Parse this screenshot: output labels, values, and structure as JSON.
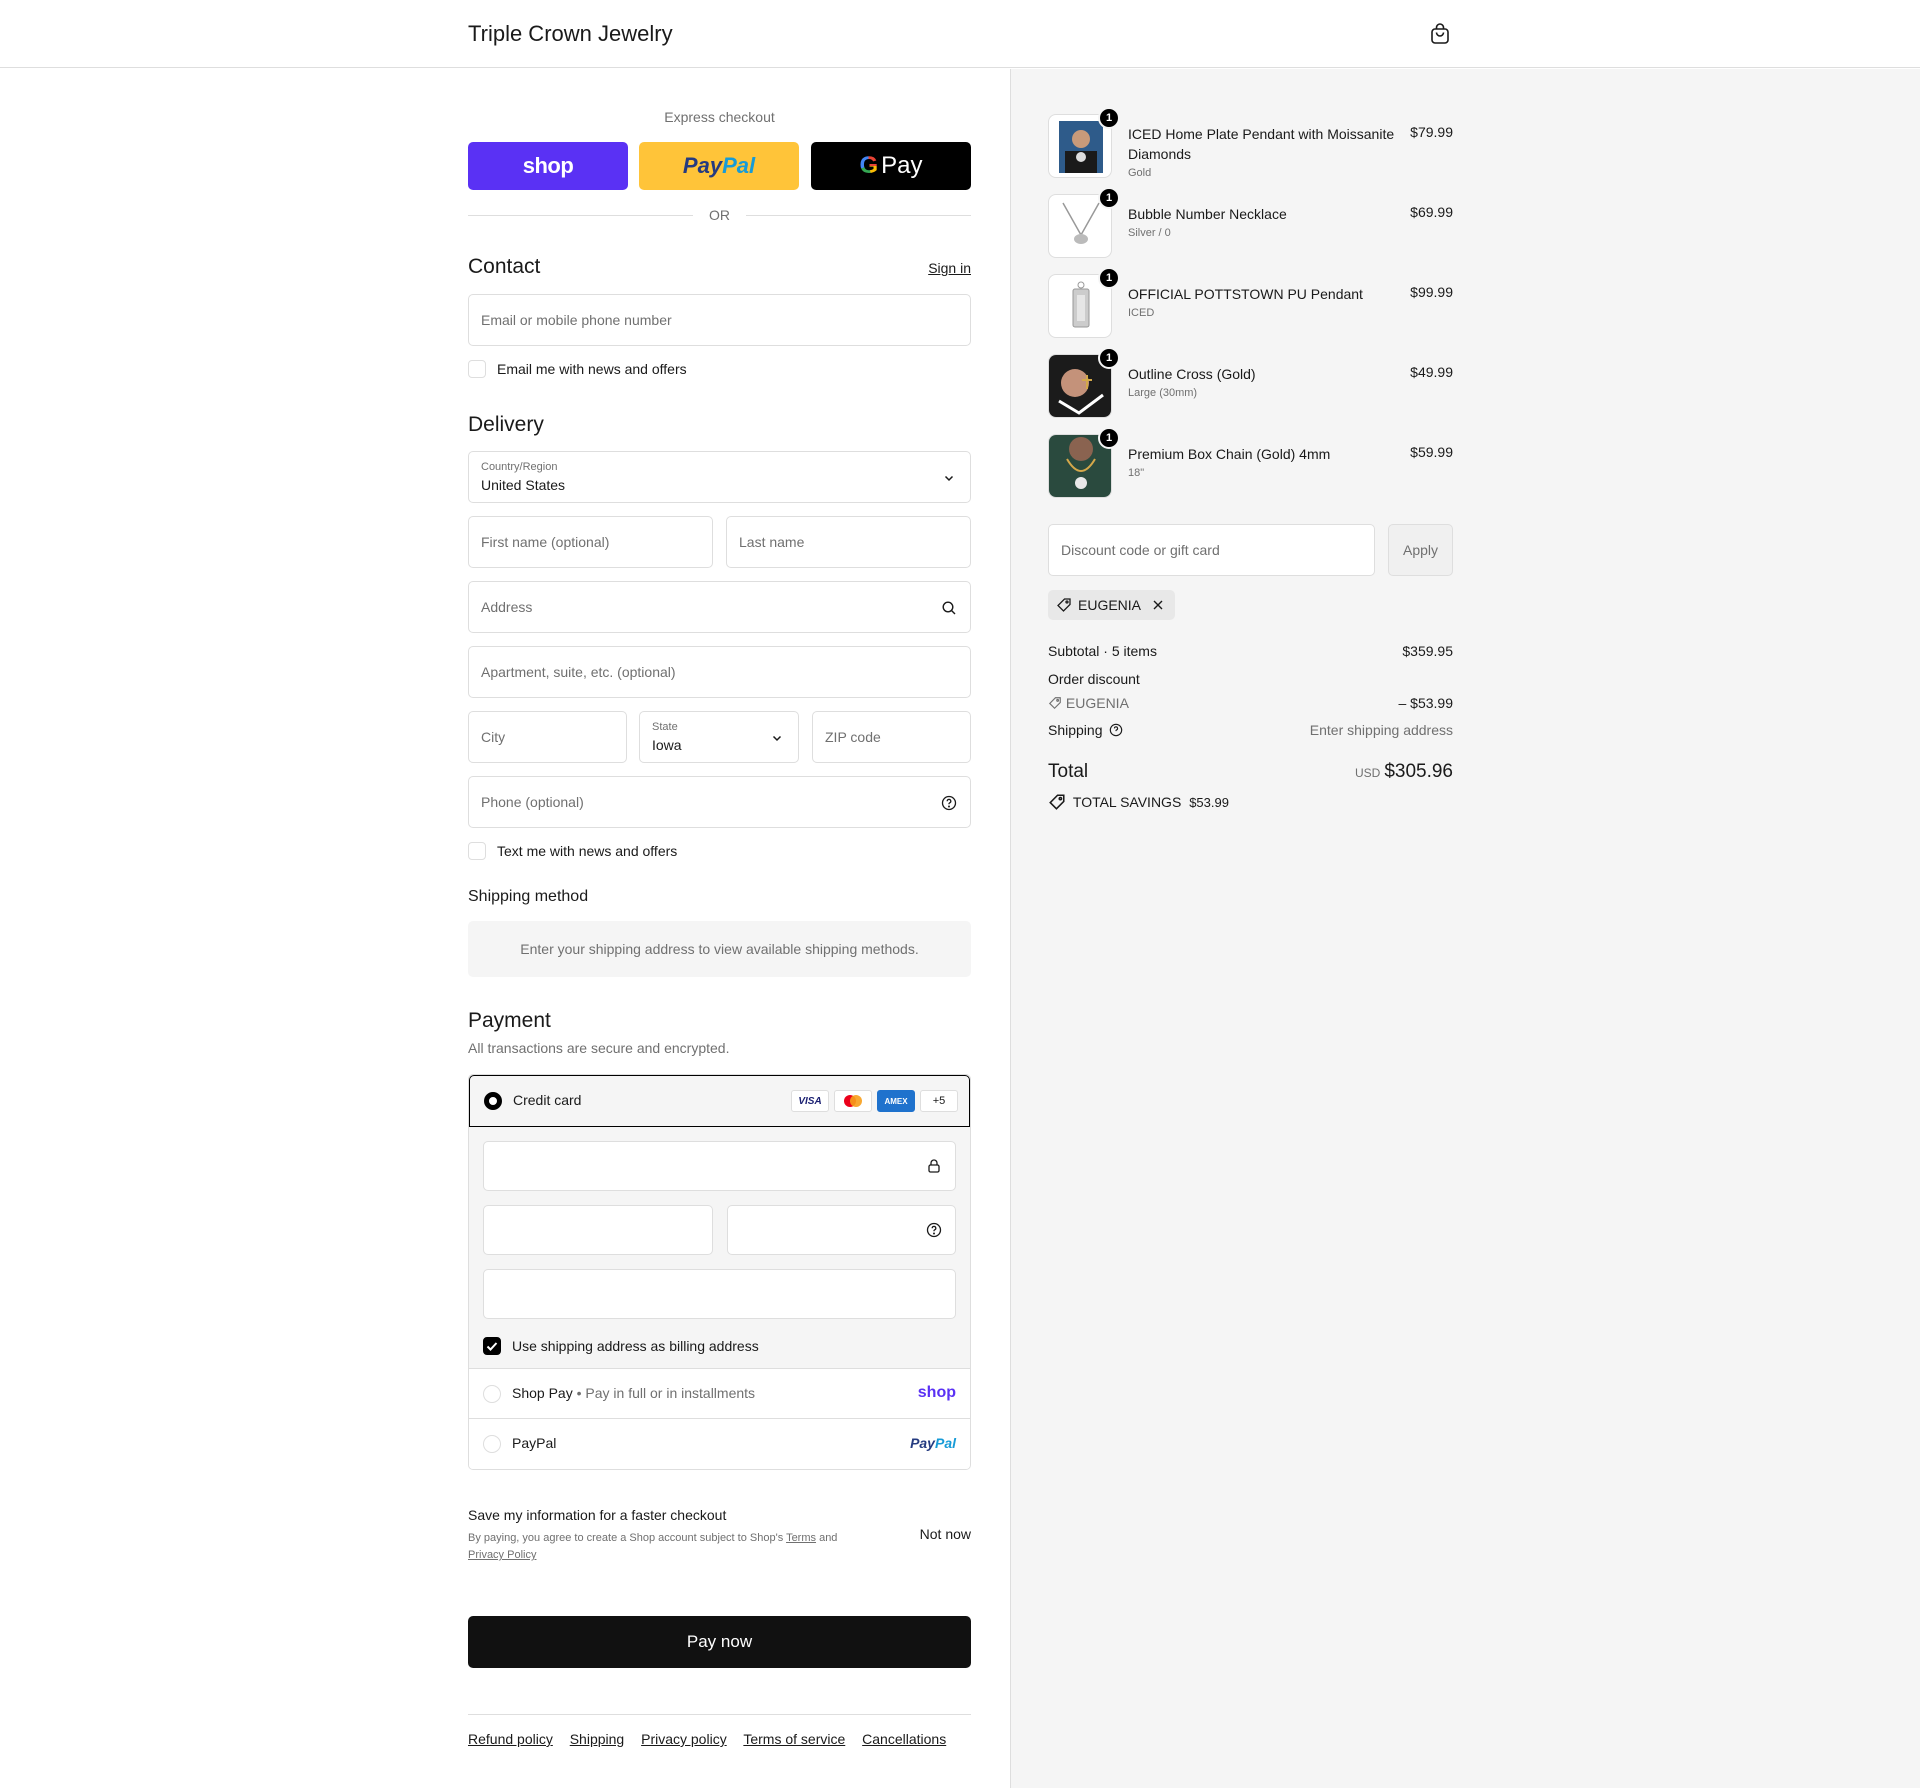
{
  "header": {
    "brand": "Triple Crown Jewelry"
  },
  "express": {
    "title": "Express checkout",
    "shop_label": "shop",
    "paypal_a": "Pay",
    "paypal_b": "Pal",
    "gpay_label": "Pay",
    "or": "OR"
  },
  "contact": {
    "heading": "Contact",
    "sign_in": "Sign in",
    "email_placeholder": "Email or mobile phone number",
    "news_label": "Email me with news and offers"
  },
  "delivery": {
    "heading": "Delivery",
    "country_label": "Country/Region",
    "country_value": "United States",
    "first_name_placeholder": "First name (optional)",
    "last_name_placeholder": "Last name",
    "address_placeholder": "Address",
    "apartment_placeholder": "Apartment, suite, etc. (optional)",
    "city_placeholder": "City",
    "state_label": "State",
    "state_value": "Iowa",
    "zip_placeholder": "ZIP code",
    "phone_placeholder": "Phone (optional)",
    "text_label": "Text me with news and offers"
  },
  "shipping_method": {
    "heading": "Shipping method",
    "message": "Enter your shipping address to view available shipping methods."
  },
  "payment": {
    "heading": "Payment",
    "subtitle": "All transactions are secure and encrypted.",
    "credit_card_label": "Credit card",
    "card_logos": [
      "VISA",
      "AMEX",
      "+5"
    ],
    "billing_label": "Use shipping address as billing address",
    "shop_pay_label": "Shop Pay",
    "shop_pay_sub": "Pay in full or in installments",
    "shop_pay_logo": "shop",
    "paypal_label": "PayPal",
    "paypal_logo_a": "Pay",
    "paypal_logo_b": "Pal"
  },
  "save_info": {
    "title": "Save my information for a faster checkout",
    "text_a": "By paying, you agree to create a Shop account subject to Shop's ",
    "terms": "Terms",
    "text_b": " and",
    "privacy": "Privacy Policy",
    "not_now": "Not now"
  },
  "pay_now": "Pay now",
  "footer_links": [
    "Refund policy",
    "Shipping",
    "Privacy policy",
    "Terms of service",
    "Cancellations"
  ],
  "items": [
    {
      "qty": "1",
      "name": "ICED Home Plate Pendant with Moissanite Diamonds",
      "variant": "Gold",
      "price": "$79.99"
    },
    {
      "qty": "1",
      "name": "Bubble Number Necklace",
      "variant": "Silver / 0",
      "price": "$69.99"
    },
    {
      "qty": "1",
      "name": "OFFICIAL POTTSTOWN PU Pendant",
      "variant": "ICED",
      "price": "$99.99"
    },
    {
      "qty": "1",
      "name": "Outline Cross (Gold)",
      "variant": "Large (30mm)",
      "price": "$49.99"
    },
    {
      "qty": "1",
      "name": "Premium Box Chain (Gold) 4mm",
      "variant": "18\"",
      "price": "$59.99"
    }
  ],
  "discount": {
    "placeholder": "Discount code or gift card",
    "apply": "Apply",
    "code": "EUGENIA"
  },
  "totals": {
    "subtotal_label": "Subtotal · 5 items",
    "subtotal_value": "$359.95",
    "order_discount_label": "Order discount",
    "discount_code": "EUGENIA",
    "discount_value": "– $53.99",
    "shipping_label": "Shipping",
    "shipping_value": "Enter shipping address",
    "total_label": "Total",
    "currency": "USD",
    "total_value": "$305.96",
    "savings_label": "TOTAL SAVINGS",
    "savings_value": "$53.99"
  },
  "colors": {
    "shop_purple": "#5a31f4",
    "paypal_yellow": "#ffc439",
    "primary": "#111111",
    "summary_bg": "#f5f5f5"
  }
}
